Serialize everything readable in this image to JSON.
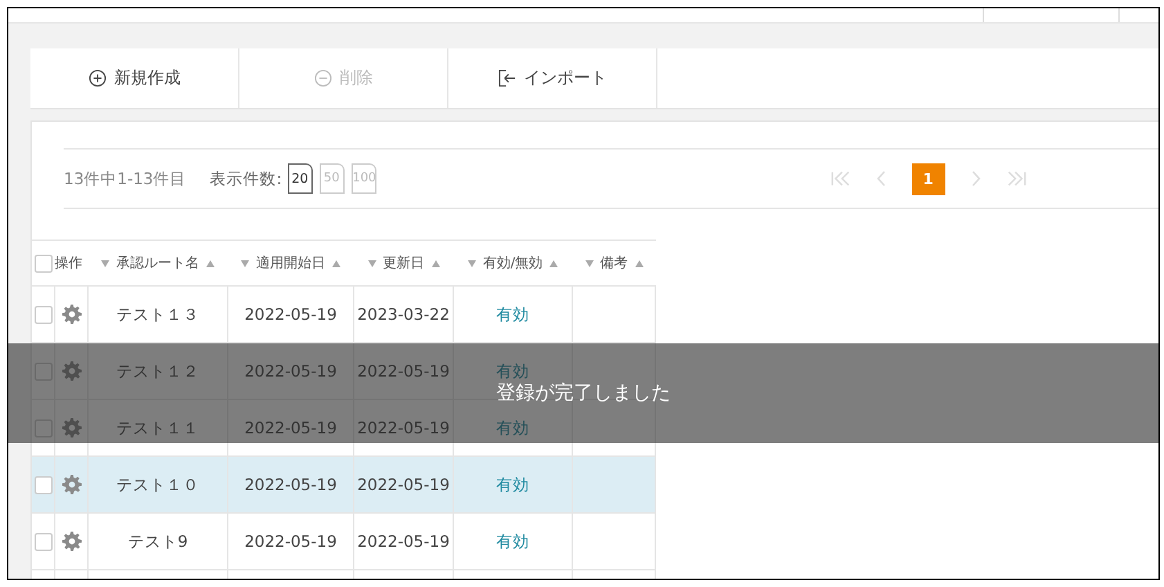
{
  "toolbar": [
    {
      "kind": "add",
      "label": "新規作成",
      "disabled": false
    },
    {
      "kind": "remove",
      "label": "削除",
      "disabled": true
    },
    {
      "kind": "import",
      "label": "インポート",
      "disabled": false
    }
  ],
  "pager": {
    "summary": "13件中1-13件目",
    "page_size_label": "表示件数:",
    "page_sizes": [
      {
        "label": "20",
        "selected": true
      },
      {
        "label": "50",
        "selected": false
      },
      {
        "label": "100",
        "selected": false
      }
    ],
    "nav": [
      {
        "kind": "first",
        "disabled": true
      },
      {
        "kind": "prev",
        "disabled": true
      },
      {
        "kind": "page",
        "label": "1",
        "selected": true
      },
      {
        "kind": "next",
        "disabled": true
      },
      {
        "kind": "last",
        "disabled": true
      }
    ]
  },
  "table": {
    "select_all_checked": false,
    "columns": [
      {
        "label": "操作",
        "sortable": false
      },
      {
        "label": "承認ルート名",
        "sortable": true
      },
      {
        "label": "適用開始日",
        "sortable": true
      },
      {
        "label": "更新日",
        "sortable": true
      },
      {
        "label": "有効/無効",
        "sortable": true
      },
      {
        "label": "備考",
        "sortable": true
      }
    ],
    "rows": [
      {
        "name": "テスト１３",
        "start": "2022-05-19",
        "updated": "2023-03-22",
        "status": "有効",
        "checked": false,
        "hovered": false
      },
      {
        "name": "テスト１２",
        "start": "2022-05-19",
        "updated": "2022-05-19",
        "status": "有効",
        "checked": false,
        "hovered": false
      },
      {
        "name": "テスト１１",
        "start": "2022-05-19",
        "updated": "2022-05-19",
        "status": "有効",
        "checked": false,
        "hovered": false
      },
      {
        "name": "テスト１０",
        "start": "2022-05-19",
        "updated": "2022-05-19",
        "status": "有効",
        "checked": false,
        "hovered": true
      },
      {
        "name": "テスト9",
        "start": "2022-05-19",
        "updated": "2022-05-19",
        "status": "有効",
        "checked": false,
        "hovered": false
      }
    ]
  },
  "toast": {
    "message": "登録が完了しました"
  }
}
